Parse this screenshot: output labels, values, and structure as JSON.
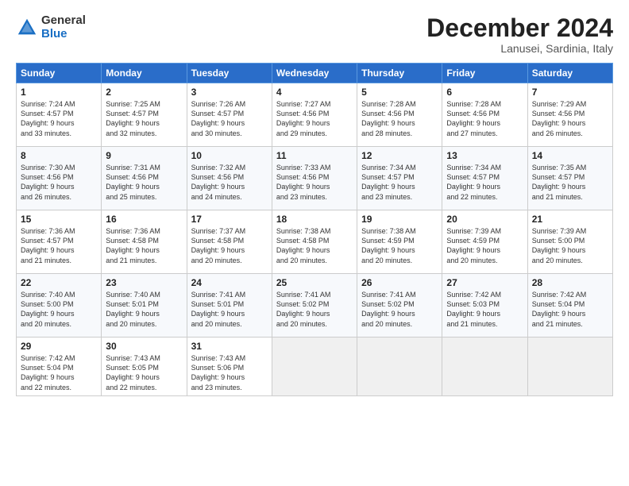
{
  "header": {
    "logo_general": "General",
    "logo_blue": "Blue",
    "month_title": "December 2024",
    "location": "Lanusei, Sardinia, Italy"
  },
  "days_of_week": [
    "Sunday",
    "Monday",
    "Tuesday",
    "Wednesday",
    "Thursday",
    "Friday",
    "Saturday"
  ],
  "weeks": [
    [
      {
        "day": 1,
        "info": "Sunrise: 7:24 AM\nSunset: 4:57 PM\nDaylight: 9 hours\nand 33 minutes."
      },
      {
        "day": 2,
        "info": "Sunrise: 7:25 AM\nSunset: 4:57 PM\nDaylight: 9 hours\nand 32 minutes."
      },
      {
        "day": 3,
        "info": "Sunrise: 7:26 AM\nSunset: 4:57 PM\nDaylight: 9 hours\nand 30 minutes."
      },
      {
        "day": 4,
        "info": "Sunrise: 7:27 AM\nSunset: 4:56 PM\nDaylight: 9 hours\nand 29 minutes."
      },
      {
        "day": 5,
        "info": "Sunrise: 7:28 AM\nSunset: 4:56 PM\nDaylight: 9 hours\nand 28 minutes."
      },
      {
        "day": 6,
        "info": "Sunrise: 7:28 AM\nSunset: 4:56 PM\nDaylight: 9 hours\nand 27 minutes."
      },
      {
        "day": 7,
        "info": "Sunrise: 7:29 AM\nSunset: 4:56 PM\nDaylight: 9 hours\nand 26 minutes."
      }
    ],
    [
      {
        "day": 8,
        "info": "Sunrise: 7:30 AM\nSunset: 4:56 PM\nDaylight: 9 hours\nand 26 minutes."
      },
      {
        "day": 9,
        "info": "Sunrise: 7:31 AM\nSunset: 4:56 PM\nDaylight: 9 hours\nand 25 minutes."
      },
      {
        "day": 10,
        "info": "Sunrise: 7:32 AM\nSunset: 4:56 PM\nDaylight: 9 hours\nand 24 minutes."
      },
      {
        "day": 11,
        "info": "Sunrise: 7:33 AM\nSunset: 4:56 PM\nDaylight: 9 hours\nand 23 minutes."
      },
      {
        "day": 12,
        "info": "Sunrise: 7:34 AM\nSunset: 4:57 PM\nDaylight: 9 hours\nand 23 minutes."
      },
      {
        "day": 13,
        "info": "Sunrise: 7:34 AM\nSunset: 4:57 PM\nDaylight: 9 hours\nand 22 minutes."
      },
      {
        "day": 14,
        "info": "Sunrise: 7:35 AM\nSunset: 4:57 PM\nDaylight: 9 hours\nand 21 minutes."
      }
    ],
    [
      {
        "day": 15,
        "info": "Sunrise: 7:36 AM\nSunset: 4:57 PM\nDaylight: 9 hours\nand 21 minutes."
      },
      {
        "day": 16,
        "info": "Sunrise: 7:36 AM\nSunset: 4:58 PM\nDaylight: 9 hours\nand 21 minutes."
      },
      {
        "day": 17,
        "info": "Sunrise: 7:37 AM\nSunset: 4:58 PM\nDaylight: 9 hours\nand 20 minutes."
      },
      {
        "day": 18,
        "info": "Sunrise: 7:38 AM\nSunset: 4:58 PM\nDaylight: 9 hours\nand 20 minutes."
      },
      {
        "day": 19,
        "info": "Sunrise: 7:38 AM\nSunset: 4:59 PM\nDaylight: 9 hours\nand 20 minutes."
      },
      {
        "day": 20,
        "info": "Sunrise: 7:39 AM\nSunset: 4:59 PM\nDaylight: 9 hours\nand 20 minutes."
      },
      {
        "day": 21,
        "info": "Sunrise: 7:39 AM\nSunset: 5:00 PM\nDaylight: 9 hours\nand 20 minutes."
      }
    ],
    [
      {
        "day": 22,
        "info": "Sunrise: 7:40 AM\nSunset: 5:00 PM\nDaylight: 9 hours\nand 20 minutes."
      },
      {
        "day": 23,
        "info": "Sunrise: 7:40 AM\nSunset: 5:01 PM\nDaylight: 9 hours\nand 20 minutes."
      },
      {
        "day": 24,
        "info": "Sunrise: 7:41 AM\nSunset: 5:01 PM\nDaylight: 9 hours\nand 20 minutes."
      },
      {
        "day": 25,
        "info": "Sunrise: 7:41 AM\nSunset: 5:02 PM\nDaylight: 9 hours\nand 20 minutes."
      },
      {
        "day": 26,
        "info": "Sunrise: 7:41 AM\nSunset: 5:02 PM\nDaylight: 9 hours\nand 20 minutes."
      },
      {
        "day": 27,
        "info": "Sunrise: 7:42 AM\nSunset: 5:03 PM\nDaylight: 9 hours\nand 21 minutes."
      },
      {
        "day": 28,
        "info": "Sunrise: 7:42 AM\nSunset: 5:04 PM\nDaylight: 9 hours\nand 21 minutes."
      }
    ],
    [
      {
        "day": 29,
        "info": "Sunrise: 7:42 AM\nSunset: 5:04 PM\nDaylight: 9 hours\nand 22 minutes."
      },
      {
        "day": 30,
        "info": "Sunrise: 7:43 AM\nSunset: 5:05 PM\nDaylight: 9 hours\nand 22 minutes."
      },
      {
        "day": 31,
        "info": "Sunrise: 7:43 AM\nSunset: 5:06 PM\nDaylight: 9 hours\nand 23 minutes."
      },
      null,
      null,
      null,
      null
    ]
  ]
}
